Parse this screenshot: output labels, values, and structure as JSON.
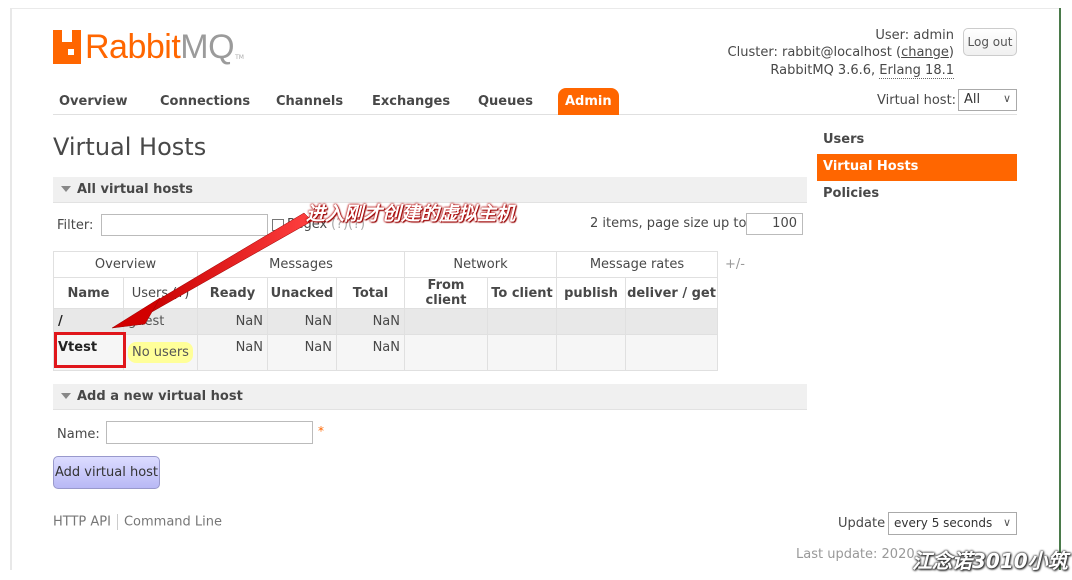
{
  "logo": {
    "part1": "Rabbit",
    "part2": "MQ",
    "tm": "TM"
  },
  "header": {
    "user_prefix": "User: ",
    "user": "admin",
    "cluster_prefix": "Cluster: ",
    "cluster": "rabbit@localhost",
    "change_link": "change",
    "version": "RabbitMQ 3.6.6,",
    "erlang": "Erlang 18.1",
    "logout_label": "Log out"
  },
  "nav": {
    "tabs": [
      {
        "label": "Overview"
      },
      {
        "label": "Connections"
      },
      {
        "label": "Channels"
      },
      {
        "label": "Exchanges"
      },
      {
        "label": "Queues"
      },
      {
        "label": "Admin"
      }
    ],
    "vhost_label": "Virtual host:",
    "vhost_selected": "All"
  },
  "page_title": "Virtual Hosts",
  "sidebar": {
    "items": [
      {
        "label": "Users"
      },
      {
        "label": "Virtual Hosts"
      },
      {
        "label": "Policies"
      }
    ]
  },
  "all_vhosts": {
    "title": "All virtual hosts",
    "filter_label": "Filter:",
    "filter_value": "",
    "regex_label": "Regex",
    "regex_help": "(?)(?)",
    "items_text": "2 items, page size up to",
    "page_size": "100",
    "plus_minus": "+/-",
    "groups": [
      "Overview",
      "Messages",
      "Network",
      "Message rates"
    ],
    "columns": [
      "Name",
      "Users (?)",
      "Ready",
      "Unacked",
      "Total",
      "From client",
      "To client",
      "publish",
      "deliver / get"
    ],
    "rows": [
      {
        "name": "/",
        "users": "guest",
        "ready": "NaN",
        "unacked": "NaN",
        "total": "NaN",
        "from_client": "",
        "to_client": "",
        "publish": "",
        "deliver_get": ""
      },
      {
        "name": "Vtest",
        "users": "No users",
        "ready": "NaN",
        "unacked": "NaN",
        "total": "NaN",
        "from_client": "",
        "to_client": "",
        "publish": "",
        "deliver_get": ""
      }
    ]
  },
  "add_vhost": {
    "title": "Add a new virtual host",
    "name_label": "Name:",
    "name_value": "",
    "required": "*",
    "button_label": "Add virtual host"
  },
  "footer": {
    "http_api": "HTTP API",
    "command_line": "Command Line",
    "update_label": "Update",
    "update_selected": "every 5 seconds",
    "last_update": "Last update: 2020"
  },
  "annotation": {
    "text": "进入刚才创建的虚拟主机",
    "color": "#e0161b"
  },
  "watermark": "江念诺3010小筑",
  "colors": {
    "accent": "#ff6600",
    "annotation": "#e0161b",
    "button": "#c4c4fa"
  }
}
